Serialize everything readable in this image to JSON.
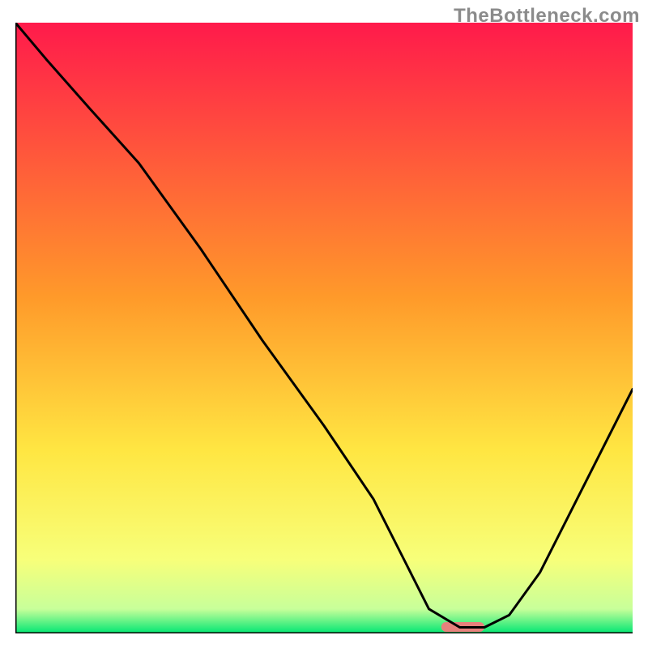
{
  "watermark": "TheBottleneck.com",
  "chart_data": {
    "type": "line",
    "title": "",
    "xlabel": "",
    "ylabel": "",
    "xlim": [
      0,
      100
    ],
    "ylim": [
      0,
      100
    ],
    "grid": false,
    "legend": false,
    "gradient_stops": [
      {
        "offset": 0.0,
        "color": "#ff1a4b"
      },
      {
        "offset": 0.45,
        "color": "#ff9a2a"
      },
      {
        "offset": 0.7,
        "color": "#ffe642"
      },
      {
        "offset": 0.88,
        "color": "#f7ff7a"
      },
      {
        "offset": 0.96,
        "color": "#c8ff9a"
      },
      {
        "offset": 1.0,
        "color": "#00e673"
      }
    ],
    "series": [
      {
        "name": "bottleneck-curve",
        "x": [
          0,
          5,
          12,
          20,
          30,
          40,
          50,
          58,
          63,
          67,
          72,
          76,
          80,
          85,
          90,
          95,
          100
        ],
        "y": [
          100,
          94,
          86,
          77,
          63,
          48,
          34,
          22,
          12,
          4,
          1,
          1,
          3,
          10,
          20,
          30,
          40
        ]
      }
    ],
    "marker": {
      "name": "optimal-range",
      "x_start": 69,
      "x_end": 76,
      "color": "#e8817c"
    }
  }
}
